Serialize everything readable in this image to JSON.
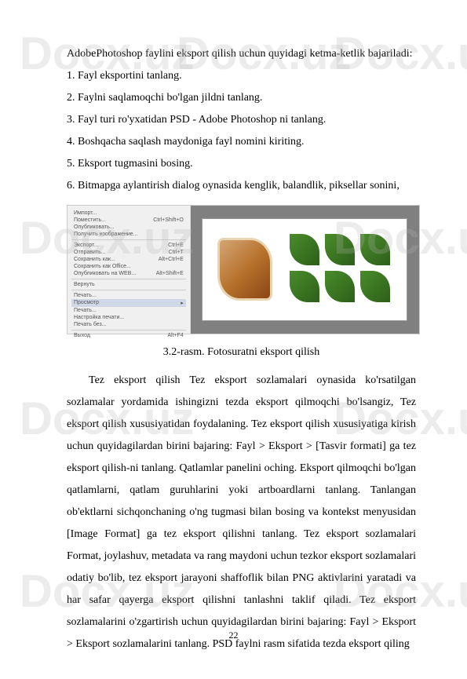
{
  "watermark": "Docx.uz",
  "intro": "AdobePhotoshop faylini eksport qilish uchun quyidagi ketma-ketlik bajariladi:",
  "steps": [
    "1. Fayl eksportini tanlang.",
    "2. Faylni saqlamoqchi bo'lgan jildni tanlang.",
    "3. Fayl turi ro'yxatidan PSD - Adobe Photoshop ni tanlang.",
    "4. Boshqacha saqlash maydoniga fayl nomini kiriting.",
    "5. Eksport tugmasini bosing.",
    "6. Bitmapga aylantirish dialog oynasida kenglik, balandlik, piksellar sonini,"
  ],
  "menu": {
    "items": [
      {
        "label": "Импорт...",
        "shortcut": ""
      },
      {
        "label": "Поместить...",
        "shortcut": "Ctrl+Shift+O"
      },
      {
        "label": "Опубликовать...",
        "shortcut": ""
      },
      {
        "label": "Получить изображение...",
        "shortcut": ""
      },
      {
        "label": "Экспорт...",
        "shortcut": "Ctrl+E"
      },
      {
        "label": "Отправить...",
        "shortcut": "Ctrl+T"
      },
      {
        "label": "Сохранить как...",
        "shortcut": "Alt+Ctrl+E"
      },
      {
        "label": "Сохранить как Office...",
        "shortcut": ""
      },
      {
        "label": "Опубликовать на WEB...",
        "shortcut": "Alt+Shift+E"
      },
      {
        "label": "Вернуть",
        "shortcut": ""
      },
      {
        "label": "Печать...",
        "shortcut": ""
      },
      {
        "label": "Просмотр",
        "shortcut": "▸"
      },
      {
        "label": "Печать...",
        "shortcut": ""
      },
      {
        "label": "Настройка печати...",
        "shortcut": ""
      },
      {
        "label": "Печать без...",
        "shortcut": ""
      },
      {
        "label": "Выход",
        "shortcut": "Alt+F4"
      }
    ]
  },
  "caption": "3.2-rasm. Fotosuratni eksport qilish",
  "body": "Tez eksport qilish Tez eksport sozlamalari oynasida ko'rsatilgan sozlamalar yordamida ishingizni tezda eksport qilmoqchi bo'lsangiz, Tez eksport qilish xususiyatidan foydalaning. Tez eksport qilish xususiyatiga kirish uchun quyidagilardan birini bajaring: Fayl > Eksport > [Tasvir formati] ga tez eksport qilish-ni tanlang. Qatlamlar panelini oching. Eksport qilmoqchi bo'lgan qatlamlarni, qatlam guruhlarini yoki artboardlarni tanlang. Tanlangan ob'ektlarni sichqonchaning o'ng tugmasi bilan bosing va kontekst menyusidan [Image Format] ga tez eksport qilishni tanlang. Tez eksport sozlamalari Format, joylashuv, metadata va rang maydoni uchun tezkor eksport sozlamalari odatiy bo'lib, tez eksport jarayoni shaffoflik bilan PNG aktivlarini yaratadi va har safar qayerga eksport qilishni tanlashni taklif qiladi. Tez eksport sozlamalarini o'zgartirish uchun quyidagilardan birini bajaring: Fayl > Eksport > Eksport sozlamalarini tanlang. PSD faylni rasm sifatida tezda eksport qiling",
  "page_number": "22"
}
